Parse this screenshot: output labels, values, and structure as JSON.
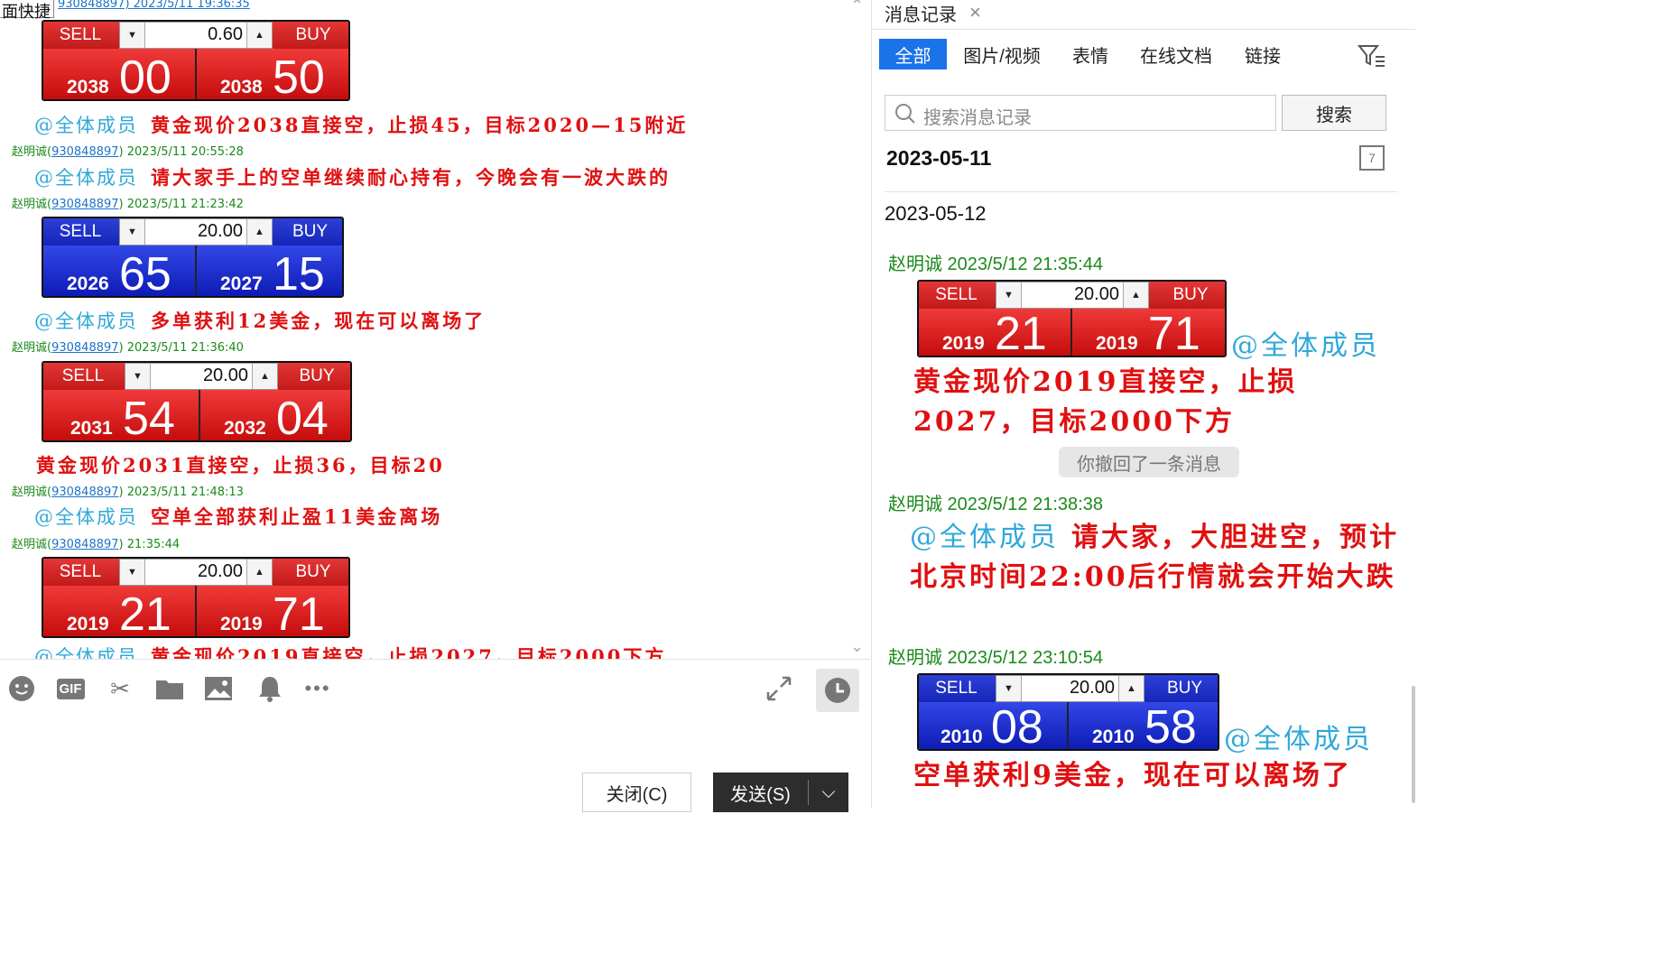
{
  "left": {
    "quick_label": "面快捷",
    "top_meta": "930848897) 2023/5/11 19:36:35",
    "widgets": [
      {
        "sell": "SELL",
        "buy": "BUY",
        "amount": "0.60",
        "sell_small": "2038",
        "sell_big": "00",
        "buy_small": "2038",
        "buy_big": "50",
        "color": "red"
      },
      {
        "sell": "SELL",
        "buy": "BUY",
        "amount": "20.00",
        "sell_small": "2026",
        "sell_big": "65",
        "buy_small": "2027",
        "buy_big": "15",
        "color": "blue"
      },
      {
        "sell": "SELL",
        "buy": "BUY",
        "amount": "20.00",
        "sell_small": "2031",
        "sell_big": "54",
        "buy_small": "2032",
        "buy_big": "04",
        "color": "red"
      },
      {
        "sell": "SELL",
        "buy": "BUY",
        "amount": "20.00",
        "sell_small": "2019",
        "sell_big": "21",
        "buy_small": "2019",
        "buy_big": "71",
        "color": "red"
      }
    ],
    "messages": [
      {
        "at": "@全体成员",
        "text": "黄金现价2038直接空，止损45，目标2020—15附近"
      },
      {
        "at": "@全体成员",
        "text": "请大家手上的空单继续耐心持有，今晚会有一波大跌的"
      },
      {
        "at": "@全体成员",
        "text": "多单获利12美金，现在可以离场了"
      },
      {
        "at": "",
        "text": "黄金现价2031直接空，止损36，目标20"
      },
      {
        "at": "@全体成员",
        "text": "空单全部获利止盈11美金离场"
      },
      {
        "at": "@全体成员",
        "text": "黄金现价2019直接空，止损2027，目标2000下方"
      }
    ],
    "metas": [
      {
        "name": "赵明诚",
        "qq": "930848897",
        "time": "2023/5/11 20:55:28"
      },
      {
        "name": "赵明诚",
        "qq": "930848897",
        "time": "2023/5/11 21:23:42"
      },
      {
        "name": "赵明诚",
        "qq": "930848897",
        "time": "2023/5/11 21:36:40"
      },
      {
        "name": "赵明诚",
        "qq": "930848897",
        "time": "2023/5/11 21:48:13"
      },
      {
        "name": "赵明诚",
        "qq": "930848897",
        "time": "21:35:44"
      }
    ]
  },
  "toolbar": {
    "icons": [
      "emoji-icon",
      "gif-icon",
      "scissors-icon",
      "folder-icon",
      "image-icon",
      "bell-icon",
      "more-icon"
    ],
    "gif_label": "GIF",
    "close_label": "关闭(C)",
    "send_label": "发送(S)"
  },
  "right": {
    "tab_title": "消息记录",
    "filters": [
      "全部",
      "图片/视频",
      "表情",
      "在线文档",
      "链接"
    ],
    "search_placeholder": "搜索消息记录",
    "search_button": "搜索",
    "date_selected": "2023-05-11",
    "date_other": "2023-05-12",
    "calendar_day": "7",
    "entries": [
      {
        "meta": "赵明诚 2023/5/12 21:35:44"
      },
      {
        "meta": "赵明诚 2023/5/12 21:38:38"
      },
      {
        "meta": "赵明诚 2023/5/12 23:10:54"
      }
    ],
    "widget1": {
      "sell": "SELL",
      "buy": "BUY",
      "amount": "20.00",
      "sell_small": "2019",
      "sell_big": "21",
      "buy_small": "2019",
      "buy_big": "71"
    },
    "widget2": {
      "sell": "SELL",
      "buy": "BUY",
      "amount": "20.00",
      "sell_small": "2010",
      "sell_big": "08",
      "buy_small": "2010",
      "buy_big": "58"
    },
    "at1": "@全体成员",
    "msg1": "黄金现价2019直接空，止损2027，目标2000下方",
    "revoked": "你撤回了一条消息",
    "at2": "@全体成员",
    "msg2": "请大家，大胆进空，预计北京时间22:00后行情就会开始大跌",
    "at3": "@全体成员",
    "msg3": "空单获利9美金，现在可以离场了"
  },
  "colors": {
    "sell_red": "#d81e1e",
    "sell_blue": "#1c2ad0",
    "msg_red": "#e01010",
    "at_blue": "#2fa8d8",
    "meta_green": "#1b8a1b",
    "tab_active": "#1a73e8"
  }
}
